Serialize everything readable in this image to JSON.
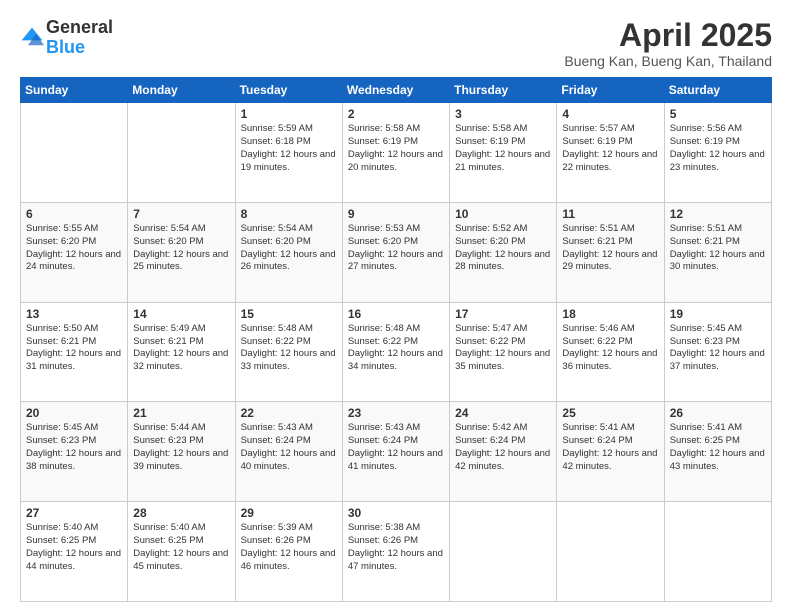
{
  "logo": {
    "general": "General",
    "blue": "Blue"
  },
  "title": "April 2025",
  "location": "Bueng Kan, Bueng Kan, Thailand",
  "days_of_week": [
    "Sunday",
    "Monday",
    "Tuesday",
    "Wednesday",
    "Thursday",
    "Friday",
    "Saturday"
  ],
  "weeks": [
    [
      {
        "day": "",
        "info": ""
      },
      {
        "day": "",
        "info": ""
      },
      {
        "day": "1",
        "info": "Sunrise: 5:59 AM\nSunset: 6:18 PM\nDaylight: 12 hours and 19 minutes."
      },
      {
        "day": "2",
        "info": "Sunrise: 5:58 AM\nSunset: 6:19 PM\nDaylight: 12 hours and 20 minutes."
      },
      {
        "day": "3",
        "info": "Sunrise: 5:58 AM\nSunset: 6:19 PM\nDaylight: 12 hours and 21 minutes."
      },
      {
        "day": "4",
        "info": "Sunrise: 5:57 AM\nSunset: 6:19 PM\nDaylight: 12 hours and 22 minutes."
      },
      {
        "day": "5",
        "info": "Sunrise: 5:56 AM\nSunset: 6:19 PM\nDaylight: 12 hours and 23 minutes."
      }
    ],
    [
      {
        "day": "6",
        "info": "Sunrise: 5:55 AM\nSunset: 6:20 PM\nDaylight: 12 hours and 24 minutes."
      },
      {
        "day": "7",
        "info": "Sunrise: 5:54 AM\nSunset: 6:20 PM\nDaylight: 12 hours and 25 minutes."
      },
      {
        "day": "8",
        "info": "Sunrise: 5:54 AM\nSunset: 6:20 PM\nDaylight: 12 hours and 26 minutes."
      },
      {
        "day": "9",
        "info": "Sunrise: 5:53 AM\nSunset: 6:20 PM\nDaylight: 12 hours and 27 minutes."
      },
      {
        "day": "10",
        "info": "Sunrise: 5:52 AM\nSunset: 6:20 PM\nDaylight: 12 hours and 28 minutes."
      },
      {
        "day": "11",
        "info": "Sunrise: 5:51 AM\nSunset: 6:21 PM\nDaylight: 12 hours and 29 minutes."
      },
      {
        "day": "12",
        "info": "Sunrise: 5:51 AM\nSunset: 6:21 PM\nDaylight: 12 hours and 30 minutes."
      }
    ],
    [
      {
        "day": "13",
        "info": "Sunrise: 5:50 AM\nSunset: 6:21 PM\nDaylight: 12 hours and 31 minutes."
      },
      {
        "day": "14",
        "info": "Sunrise: 5:49 AM\nSunset: 6:21 PM\nDaylight: 12 hours and 32 minutes."
      },
      {
        "day": "15",
        "info": "Sunrise: 5:48 AM\nSunset: 6:22 PM\nDaylight: 12 hours and 33 minutes."
      },
      {
        "day": "16",
        "info": "Sunrise: 5:48 AM\nSunset: 6:22 PM\nDaylight: 12 hours and 34 minutes."
      },
      {
        "day": "17",
        "info": "Sunrise: 5:47 AM\nSunset: 6:22 PM\nDaylight: 12 hours and 35 minutes."
      },
      {
        "day": "18",
        "info": "Sunrise: 5:46 AM\nSunset: 6:22 PM\nDaylight: 12 hours and 36 minutes."
      },
      {
        "day": "19",
        "info": "Sunrise: 5:45 AM\nSunset: 6:23 PM\nDaylight: 12 hours and 37 minutes."
      }
    ],
    [
      {
        "day": "20",
        "info": "Sunrise: 5:45 AM\nSunset: 6:23 PM\nDaylight: 12 hours and 38 minutes."
      },
      {
        "day": "21",
        "info": "Sunrise: 5:44 AM\nSunset: 6:23 PM\nDaylight: 12 hours and 39 minutes."
      },
      {
        "day": "22",
        "info": "Sunrise: 5:43 AM\nSunset: 6:24 PM\nDaylight: 12 hours and 40 minutes."
      },
      {
        "day": "23",
        "info": "Sunrise: 5:43 AM\nSunset: 6:24 PM\nDaylight: 12 hours and 41 minutes."
      },
      {
        "day": "24",
        "info": "Sunrise: 5:42 AM\nSunset: 6:24 PM\nDaylight: 12 hours and 42 minutes."
      },
      {
        "day": "25",
        "info": "Sunrise: 5:41 AM\nSunset: 6:24 PM\nDaylight: 12 hours and 42 minutes."
      },
      {
        "day": "26",
        "info": "Sunrise: 5:41 AM\nSunset: 6:25 PM\nDaylight: 12 hours and 43 minutes."
      }
    ],
    [
      {
        "day": "27",
        "info": "Sunrise: 5:40 AM\nSunset: 6:25 PM\nDaylight: 12 hours and 44 minutes."
      },
      {
        "day": "28",
        "info": "Sunrise: 5:40 AM\nSunset: 6:25 PM\nDaylight: 12 hours and 45 minutes."
      },
      {
        "day": "29",
        "info": "Sunrise: 5:39 AM\nSunset: 6:26 PM\nDaylight: 12 hours and 46 minutes."
      },
      {
        "day": "30",
        "info": "Sunrise: 5:38 AM\nSunset: 6:26 PM\nDaylight: 12 hours and 47 minutes."
      },
      {
        "day": "",
        "info": ""
      },
      {
        "day": "",
        "info": ""
      },
      {
        "day": "",
        "info": ""
      }
    ]
  ]
}
